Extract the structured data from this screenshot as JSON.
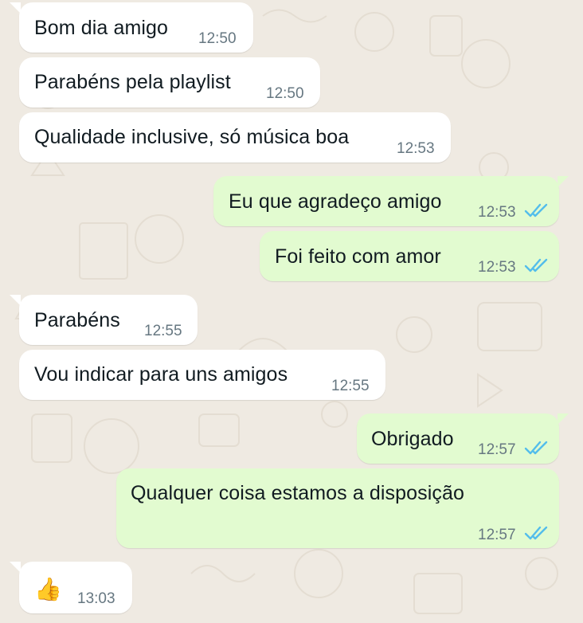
{
  "colors": {
    "background": "#efeae2",
    "incoming_bubble": "#ffffff",
    "outgoing_bubble": "#e2fbd0",
    "text": "#111b21",
    "time": "#667781",
    "read_ticks": "#53bdeb"
  },
  "messages": [
    {
      "direction": "in",
      "text": "Bom dia amigo",
      "time": "12:50"
    },
    {
      "direction": "in",
      "text": "Parabéns pela playlist",
      "time": "12:50"
    },
    {
      "direction": "in",
      "text": "Qualidade inclusive, só música boa",
      "time": "12:53"
    },
    {
      "direction": "out",
      "text": "Eu que agradeço amigo",
      "time": "12:53",
      "status": "read-ticks-icon"
    },
    {
      "direction": "out",
      "text": "Foi feito com amor",
      "time": "12:53",
      "status": "read-ticks-icon"
    },
    {
      "direction": "in",
      "text": "Parabéns",
      "time": "12:55"
    },
    {
      "direction": "in",
      "text": "Vou indicar para uns amigos",
      "time": "12:55"
    },
    {
      "direction": "out",
      "text": "Obrigado",
      "time": "12:57",
      "status": "read-ticks-icon"
    },
    {
      "direction": "out",
      "text": "Qualquer coisa estamos a disposição",
      "time": "12:57",
      "status": "read-ticks-icon"
    },
    {
      "direction": "in",
      "text": "👍",
      "time": "13:03",
      "icon": "thumbs-up-icon"
    }
  ]
}
